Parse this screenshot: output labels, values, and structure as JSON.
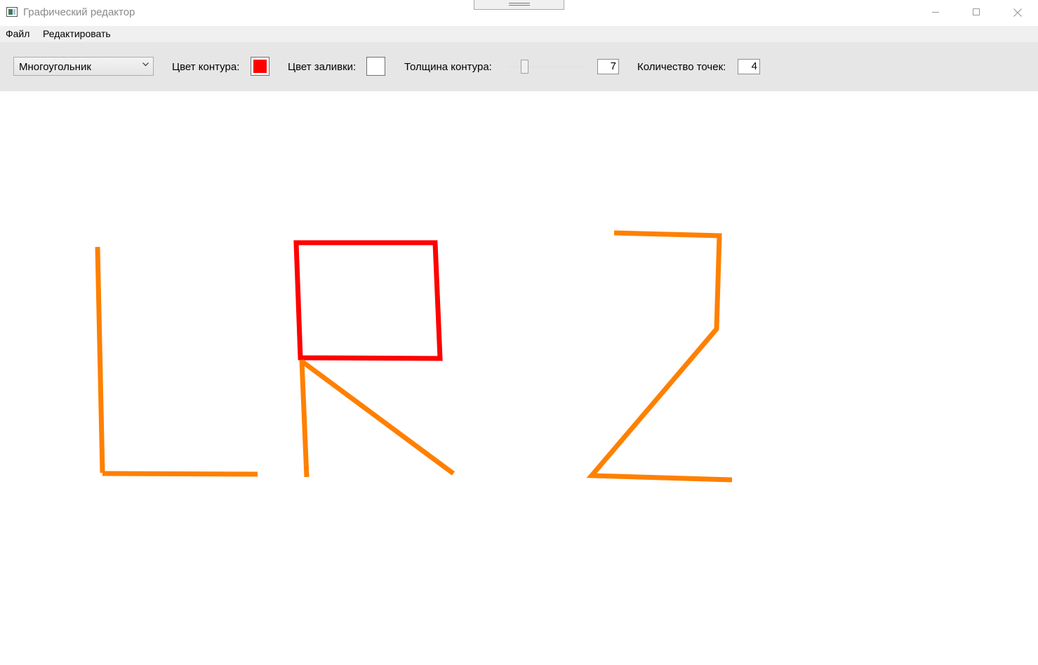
{
  "window": {
    "title": "Графический редактор",
    "icon": "app-icon"
  },
  "menu": {
    "file": "Файл",
    "edit": "Редактировать"
  },
  "toolbar": {
    "shape_selected": "Многоугольник",
    "outline_color_label": "Цвет контура:",
    "outline_color": "#ff0000",
    "fill_color_label": "Цвет заливки:",
    "fill_color": "#ffffff",
    "thickness_label": "Толщина контура:",
    "thickness_value": "7",
    "points_label": "Количество точек:",
    "points_value": "4"
  },
  "colors": {
    "orange_stroke": "#ff8000",
    "red_stroke": "#ff0000",
    "toolbar_bg": "#e6e6e6",
    "menubar_bg": "#f0f0f0"
  }
}
